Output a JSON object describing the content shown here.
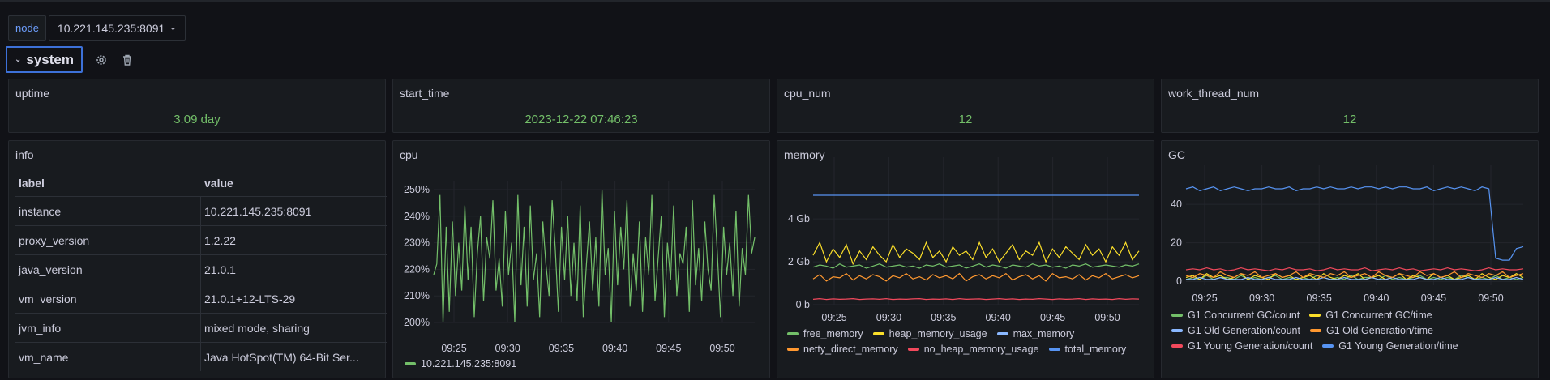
{
  "variables": {
    "label": "node",
    "value": "10.221.145.235:8091"
  },
  "row": {
    "title": "system"
  },
  "stats": [
    {
      "title": "uptime",
      "value": "3.09 day"
    },
    {
      "title": "start_time",
      "value": "2023-12-22 07:46:23"
    },
    {
      "title": "cpu_num",
      "value": "12"
    },
    {
      "title": "work_thread_num",
      "value": "12"
    }
  ],
  "info": {
    "title": "info",
    "headers": [
      "label",
      "value"
    ],
    "rows": [
      [
        "instance",
        "10.221.145.235:8091"
      ],
      [
        "proxy_version",
        "1.2.22"
      ],
      [
        "java_version",
        "21.0.1"
      ],
      [
        "vm_version",
        "21.0.1+12-LTS-29"
      ],
      [
        "jvm_info",
        "mixed mode, sharing"
      ],
      [
        "vm_name",
        "Java HotSpot(TM) 64-Bit Ser..."
      ]
    ]
  },
  "colors": {
    "green": "#73bf69",
    "yellow": "#fade2a",
    "blue": "#5794f2",
    "orange": "#ff9830",
    "red": "#f2495c",
    "accent": "#3d71d9"
  },
  "chart_data": [
    {
      "title": "cpu",
      "type": "line",
      "x_ticks": [
        "09:25",
        "09:30",
        "09:35",
        "09:40",
        "09:45",
        "09:50"
      ],
      "y_ticks": [
        "200%",
        "210%",
        "220%",
        "230%",
        "240%",
        "250%"
      ],
      "ylim": [
        200,
        250
      ],
      "series": [
        {
          "name": "10.221.145.235:8091",
          "color": "#73bf69",
          "values": [
            218,
            222,
            248,
            200,
            236,
            204,
            238,
            210,
            230,
            212,
            244,
            216,
            236,
            202,
            226,
            240,
            208,
            232,
            224,
            246,
            212,
            224,
            206,
            242,
            218,
            230,
            200,
            248,
            214,
            236,
            206,
            244,
            216,
            226,
            202,
            238,
            222,
            210,
            246,
            228,
            204,
            236,
            216,
            240,
            210,
            230,
            208,
            244,
            202,
            222,
            238,
            212,
            232,
            206,
            250,
            218,
            228,
            200,
            242,
            214,
            236,
            220,
            246,
            206,
            226,
            212,
            238,
            204,
            232,
            218,
            248,
            208,
            224,
            240,
            202,
            230,
            216,
            244,
            210,
            226,
            222,
            236,
            204,
            246,
            214,
            228,
            208,
            238,
            220,
            212,
            248,
            226,
            202,
            236,
            218,
            230,
            210,
            242,
            206,
            228,
            218,
            248,
            226,
            232
          ]
        }
      ]
    },
    {
      "title": "memory",
      "type": "line",
      "x_ticks": [
        "09:25",
        "09:30",
        "09:35",
        "09:40",
        "09:45",
        "09:50"
      ],
      "y_ticks": [
        "0 b",
        "2 Gb",
        "4 Gb"
      ],
      "ylim": [
        0,
        6.5
      ],
      "series": [
        {
          "name": "free_memory",
          "color": "#73bf69",
          "values": [
            1.75,
            1.85,
            1.8,
            1.7,
            1.9,
            1.75,
            1.8,
            1.85,
            1.7,
            1.8,
            1.9,
            1.75,
            1.8,
            1.85,
            1.75,
            1.8,
            1.7,
            1.85,
            1.8,
            1.9,
            1.75,
            1.8,
            1.85,
            1.7,
            1.8,
            1.9,
            1.75,
            1.85,
            1.8,
            1.7,
            1.85,
            1.8,
            1.75,
            1.9,
            1.8,
            1.85,
            1.75,
            1.8,
            1.7,
            1.85,
            1.8,
            1.9,
            1.75,
            1.8,
            1.85,
            1.8,
            1.75,
            1.85,
            1.8,
            1.9
          ]
        },
        {
          "name": "heap_memory_usage",
          "color": "#fade2a",
          "values": [
            2.3,
            2.9,
            2.0,
            2.6,
            2.2,
            2.8,
            1.9,
            2.5,
            2.1,
            2.7,
            2.3,
            2.0,
            2.8,
            2.2,
            2.6,
            2.4,
            2.1,
            2.9,
            2.2,
            2.5,
            2.0,
            2.7,
            2.3,
            2.5,
            2.1,
            2.9,
            2.2,
            2.6,
            2.0,
            2.4,
            2.8,
            2.1,
            2.5,
            2.3,
            2.9,
            2.0,
            2.6,
            2.2,
            2.7,
            2.4,
            2.1,
            2.8,
            2.3,
            2.6,
            2.0,
            2.7,
            2.3,
            2.9,
            2.1,
            2.5
          ]
        },
        {
          "name": "max_memory",
          "color": "#8ab8ff",
          "values": []
        },
        {
          "name": "netty_direct_memory",
          "color": "#ff9830",
          "values": [
            1.2,
            1.4,
            1.1,
            1.3,
            1.25,
            1.45,
            1.15,
            1.35,
            1.2,
            1.4,
            1.3,
            1.1,
            1.35,
            1.25,
            1.45,
            1.2,
            1.3,
            1.15,
            1.4,
            1.25,
            1.35,
            1.2,
            1.45,
            1.1,
            1.3,
            1.4,
            1.2,
            1.35,
            1.25,
            1.45,
            1.15,
            1.3,
            1.4,
            1.2,
            1.35,
            1.1,
            1.45,
            1.25,
            1.3,
            1.2,
            1.4,
            1.15,
            1.35,
            1.25,
            1.45,
            1.2,
            1.3,
            1.4,
            1.25,
            1.35
          ]
        },
        {
          "name": "no_heap_memory_usage",
          "color": "#f2495c",
          "values": [
            0.25,
            0.28,
            0.24,
            0.27,
            0.25,
            0.26,
            0.28,
            0.24,
            0.26,
            0.27,
            0.25,
            0.28,
            0.24,
            0.26,
            0.25,
            0.27,
            0.28,
            0.24,
            0.26,
            0.25,
            0.27,
            0.24,
            0.28,
            0.25,
            0.26,
            0.27,
            0.24,
            0.26,
            0.28,
            0.25,
            0.27,
            0.24,
            0.26,
            0.25,
            0.28,
            0.26,
            0.24,
            0.27,
            0.25,
            0.26,
            0.28,
            0.24,
            0.27,
            0.25,
            0.26,
            0.24,
            0.28,
            0.25,
            0.27,
            0.26
          ]
        },
        {
          "name": "total_memory",
          "color": "#5794f2",
          "values": [
            5.1,
            5.1,
            5.1,
            5.1,
            5.1,
            5.1,
            5.1,
            5.1,
            5.1,
            5.1,
            5.1,
            5.1,
            5.1,
            5.1,
            5.1,
            5.1,
            5.1,
            5.1,
            5.1,
            5.1,
            5.1,
            5.1,
            5.1,
            5.1,
            5.1,
            5.1,
            5.1,
            5.1,
            5.1,
            5.1,
            5.1,
            5.1,
            5.1,
            5.1,
            5.1,
            5.1,
            5.1,
            5.1,
            5.1,
            5.1,
            5.1,
            5.1,
            5.1,
            5.1,
            5.1,
            5.1,
            5.1,
            5.1,
            5.1,
            5.1
          ]
        }
      ]
    },
    {
      "title": "GC",
      "type": "line",
      "x_ticks": [
        "09:25",
        "09:30",
        "09:35",
        "09:40",
        "09:45",
        "09:50"
      ],
      "y_ticks": [
        "0",
        "20",
        "40"
      ],
      "ylim": [
        -2,
        56
      ],
      "series": [
        {
          "name": "G1 Concurrent GC/count",
          "color": "#73bf69",
          "values": [
            1,
            2,
            1,
            3,
            1,
            2,
            2,
            1,
            3,
            1,
            2,
            1,
            2,
            3,
            1,
            2,
            1,
            2,
            1,
            3,
            2,
            1,
            2,
            1,
            3,
            1,
            2,
            2,
            1,
            3,
            1,
            2,
            1,
            2,
            3,
            1,
            2,
            1,
            2,
            1,
            3,
            2,
            1,
            2,
            1,
            3,
            1,
            2,
            1,
            2
          ]
        },
        {
          "name": "G1 Concurrent GC/time",
          "color": "#fade2a",
          "values": [
            2,
            3,
            1,
            4,
            2,
            3,
            1,
            2,
            4,
            1,
            3,
            2,
            1,
            4,
            2,
            3,
            1,
            2,
            3,
            1,
            4,
            2,
            1,
            3,
            2,
            4,
            1,
            2,
            3,
            1,
            2,
            4,
            1,
            3,
            2,
            1,
            4,
            2,
            3,
            1,
            2,
            3,
            1,
            4,
            2,
            1,
            3,
            2,
            4,
            2
          ]
        },
        {
          "name": "G1 Old Generation/count",
          "color": "#8ab8ff",
          "values": [
            1,
            1,
            2,
            1,
            1,
            2,
            1,
            1,
            1,
            2,
            1,
            1,
            2,
            1,
            1,
            1,
            2,
            1,
            1,
            1,
            2,
            1,
            1,
            2,
            1,
            1,
            1,
            2,
            1,
            1,
            2,
            1,
            1,
            1,
            2,
            1,
            1,
            2,
            1,
            1,
            1,
            2,
            1,
            1,
            1,
            2,
            1,
            1,
            2,
            1
          ]
        },
        {
          "name": "G1 Old Generation/time",
          "color": "#ff9830",
          "values": [
            3,
            2,
            4,
            3,
            2,
            5,
            3,
            2,
            4,
            3,
            5,
            2,
            3,
            4,
            2,
            3,
            5,
            2,
            4,
            3,
            2,
            4,
            3,
            5,
            2,
            3,
            4,
            2,
            5,
            3,
            2,
            4,
            3,
            2,
            5,
            3,
            4,
            2,
            3,
            5,
            2,
            4,
            3,
            2,
            4,
            3,
            5,
            2,
            3,
            4
          ]
        },
        {
          "name": "G1 Young Generation/count",
          "color": "#f2495c",
          "values": [
            6,
            6.5,
            6,
            7,
            6,
            6.5,
            5.5,
            6,
            7,
            6,
            6.5,
            6,
            5.5,
            6.5,
            6,
            7,
            6,
            6,
            6.5,
            5.5,
            6,
            7,
            6,
            6.5,
            6,
            6,
            7,
            5.5,
            6,
            6.5,
            6,
            7,
            6,
            6.5,
            5.5,
            6,
            6.5,
            6,
            7,
            6,
            6.5,
            6,
            5.5,
            6,
            7,
            6,
            6.5,
            6,
            6,
            6.5
          ]
        },
        {
          "name": "G1 Young Generation/time",
          "color": "#5794f2",
          "values": [
            48,
            49,
            47,
            48,
            49,
            47,
            48,
            49,
            48,
            47,
            48,
            48,
            49,
            48,
            48,
            49,
            47,
            48,
            48,
            49,
            48,
            49,
            48,
            48,
            49,
            48,
            49,
            49,
            48,
            49,
            48,
            49,
            49,
            48,
            48,
            49,
            47,
            48,
            49,
            48,
            49,
            48,
            47,
            49,
            48,
            12,
            11,
            11,
            17,
            18
          ]
        }
      ]
    }
  ]
}
